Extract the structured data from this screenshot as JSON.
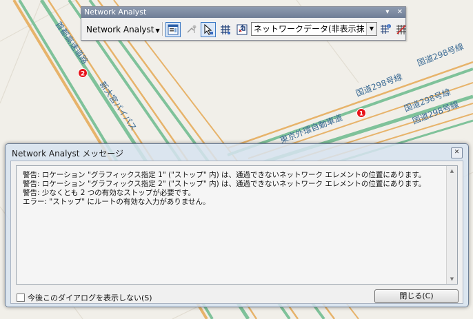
{
  "map": {
    "labels": {
      "shuto": "首都高速道路",
      "shin_omiya": "新大宮バイパス",
      "gaikan": "東京外環自動車道",
      "route298": "国道298号線"
    },
    "markers": {
      "m1": "1",
      "m2": "2"
    },
    "colors": {
      "background": "#f1efe9",
      "major_road": "#7fc29a",
      "road_outline": "#e7b36a",
      "marker": "#e8141b"
    }
  },
  "toolbar": {
    "title": "Network Analyst",
    "menu_label": "Network Analyst",
    "combo_value": "ネットワークデータ(非表示抹",
    "pin_icon": "pin-icon",
    "close_icon": "close-icon"
  },
  "dialog": {
    "title": "Network Analyst メッセージ",
    "messages": [
      "警告: ロケーション \"グラフィックス指定 1\" (\"ストップ\" 内) は、通過できないネットワーク エレメントの位置にあります。",
      "警告: ロケーション \"グラフィックス指定 2\" (\"ストップ\" 内) は、通過できないネットワーク エレメントの位置にあります。",
      "警告: 少なくとも 2 つの有効なストップが必要です。",
      "エラー: \"ストップ\" にルートの有効な入力がありません。"
    ],
    "checkbox_label": "今後このダイアログを表示しない(S)",
    "close_button": "閉じる(C)"
  }
}
